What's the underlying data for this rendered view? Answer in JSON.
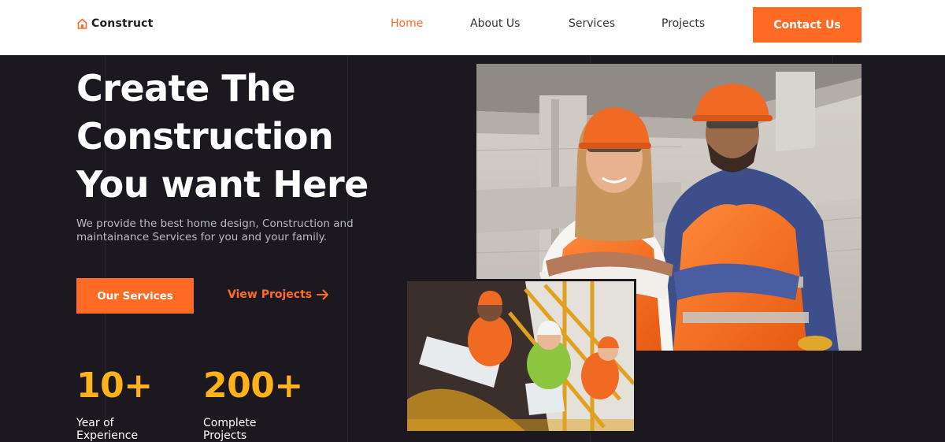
{
  "nav": {
    "brand": "Construct",
    "links": [
      {
        "label": "Home",
        "active": true
      },
      {
        "label": "About Us",
        "active": false
      },
      {
        "label": "Services",
        "active": false
      },
      {
        "label": "Projects",
        "active": false
      }
    ],
    "cta_label": "Contact Us"
  },
  "hero": {
    "title_lines": [
      "Create The",
      "Construction",
      "You want Here"
    ],
    "subtitle": "We provide the best home design, Construction and maintainance Services for you and your family.",
    "primary_button": "Our Services",
    "secondary_link": "View Projects"
  },
  "stats": [
    {
      "value": "10+",
      "label": "Year of Experience"
    },
    {
      "value": "200+",
      "label": "Complete Projects"
    }
  ],
  "colors": {
    "accent": "#ff6b25",
    "stat": "#ffb21a",
    "background": "#1b1820",
    "nav_bg": "#ffffff"
  },
  "icons": {
    "logo": "house-icon",
    "link_arrow": "arrow-right-icon"
  }
}
